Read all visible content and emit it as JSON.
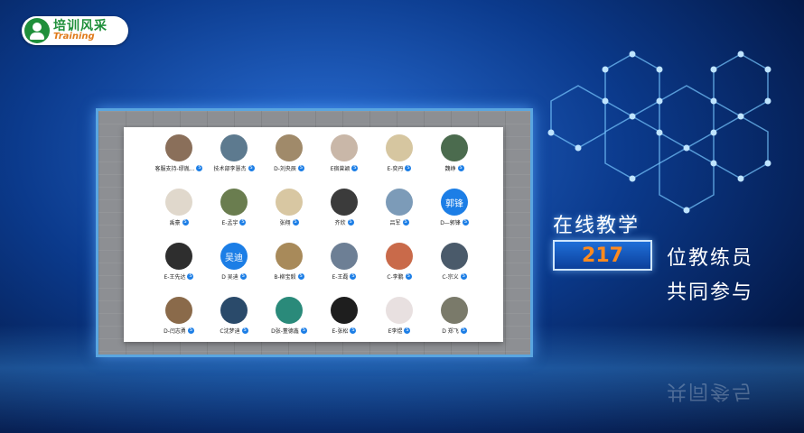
{
  "logo": {
    "name_cn": "培训风采",
    "name_en": "Training"
  },
  "members": [
    {
      "name": "客服支持-缪胤...",
      "avatar_type": "photo"
    },
    {
      "name": "技术部李慧杰",
      "avatar_type": "photo"
    },
    {
      "name": "D-刘央辰",
      "avatar_type": "photo"
    },
    {
      "name": "E宿曾颖",
      "avatar_type": "photo"
    },
    {
      "name": "E-奕丹",
      "avatar_type": "photo"
    },
    {
      "name": "魏峥",
      "avatar_type": "photo"
    },
    {
      "name": "禹豪",
      "avatar_type": "photo"
    },
    {
      "name": "E-孟宇",
      "avatar_type": "photo"
    },
    {
      "name": "张翔",
      "avatar_type": "photo"
    },
    {
      "name": "齐欣",
      "avatar_type": "photo"
    },
    {
      "name": "吕军",
      "avatar_type": "photo"
    },
    {
      "name": "D—郭锋",
      "avatar_type": "text",
      "avatar_text": "郭锋"
    },
    {
      "name": "E-王先达",
      "avatar_type": "photo"
    },
    {
      "name": "D 吴迪",
      "avatar_type": "text",
      "avatar_text": "吴迪"
    },
    {
      "name": "B-柳宝毅",
      "avatar_type": "photo"
    },
    {
      "name": "E-王磊",
      "avatar_type": "photo"
    },
    {
      "name": "C-李鹏",
      "avatar_type": "photo"
    },
    {
      "name": "C-宗义",
      "avatar_type": "photo"
    },
    {
      "name": "D-闫志勇",
      "avatar_type": "photo"
    },
    {
      "name": "C沈梦迪",
      "avatar_type": "photo"
    },
    {
      "name": "D张-董德鑫",
      "avatar_type": "photo"
    },
    {
      "name": "E-张松",
      "avatar_type": "photo"
    },
    {
      "name": "E李煜",
      "avatar_type": "photo"
    },
    {
      "name": "D 郑飞",
      "avatar_type": "photo"
    }
  ],
  "badge_symbol": "S",
  "stats": {
    "online_label": "在线教学",
    "count": "217",
    "coach_label": "位教练员",
    "together_label": "共同参与"
  },
  "colors": {
    "accent": "#1c7ee6",
    "count_color": "#ff8a1e",
    "logo_green": "#1f8f3a",
    "logo_orange": "#e07a1a"
  }
}
